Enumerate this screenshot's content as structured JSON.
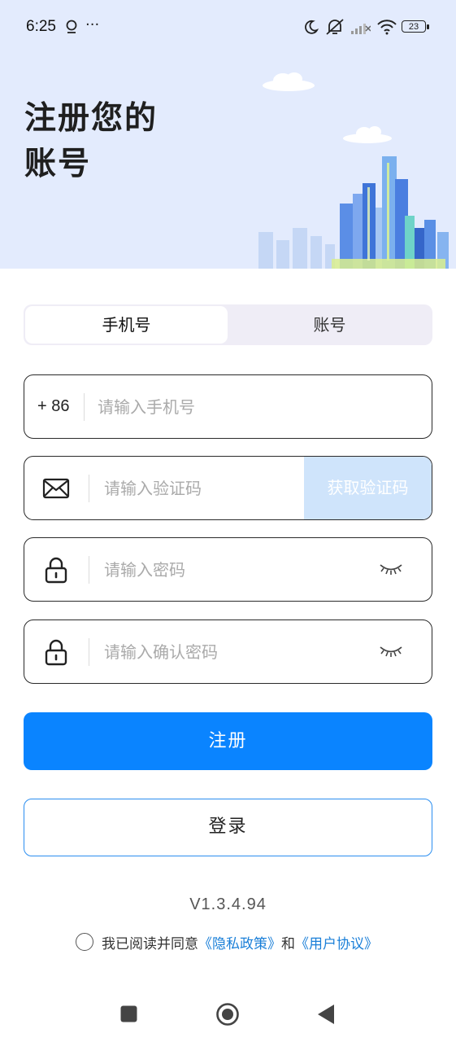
{
  "status_bar": {
    "time": "6:25",
    "more": "···",
    "battery": "23"
  },
  "header": {
    "title_line1": "注册您的",
    "title_line2": "账号"
  },
  "tabs": [
    {
      "label": "手机号",
      "active": true
    },
    {
      "label": "账号",
      "active": false
    }
  ],
  "form": {
    "phone_prefix": "+ 86",
    "phone_placeholder": "请输入手机号",
    "code_placeholder": "请输入验证码",
    "get_code_label": "获取验证码",
    "password_placeholder": "请输入密码",
    "confirm_placeholder": "请输入确认密码"
  },
  "buttons": {
    "register": "注册",
    "login": "登录"
  },
  "footer": {
    "version": "V1.3.4.94",
    "agree_prefix": "我已阅读并同意",
    "privacy_link": "《隐私政策》",
    "and": "和",
    "terms_link": "《用户协议》"
  },
  "colors": {
    "primary": "#0a84ff",
    "hero_bg": "#e3ebfd",
    "code_btn_bg": "#cfe4fb",
    "link": "#1a7fd8"
  },
  "icons": [
    "location-pin-icon",
    "moon-icon",
    "mute-bell-icon",
    "signal-icon",
    "wifi-icon",
    "battery-icon",
    "mail-icon",
    "lock-icon",
    "eye-closed-icon",
    "nav-recents-icon",
    "nav-home-icon",
    "nav-back-icon"
  ]
}
